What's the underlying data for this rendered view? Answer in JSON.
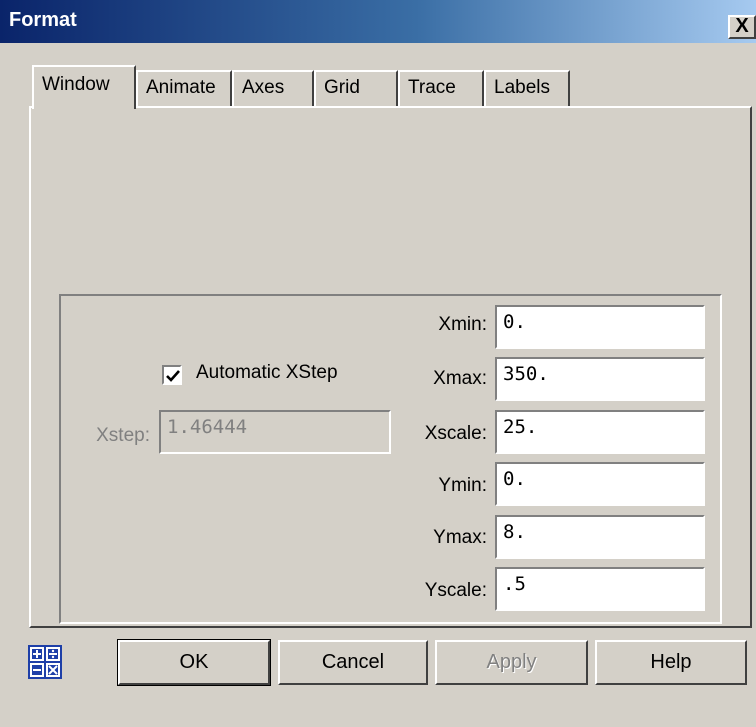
{
  "window": {
    "title": "Format",
    "close_glyph": "X"
  },
  "tabs": [
    {
      "label": "Window",
      "active": true
    },
    {
      "label": "Animate",
      "active": false
    },
    {
      "label": "Axes",
      "active": false
    },
    {
      "label": "Grid",
      "active": false
    },
    {
      "label": "Trace",
      "active": false
    },
    {
      "label": "Labels",
      "active": false
    }
  ],
  "window_settings": {
    "auto_xstep": {
      "label": "Automatic XStep",
      "checked": true
    },
    "xstep": {
      "label": "Xstep:",
      "value": "1.46444",
      "disabled": true
    },
    "xmin": {
      "label": "Xmin:",
      "value": "0."
    },
    "xmax": {
      "label": "Xmax:",
      "value": "350."
    },
    "xscale": {
      "label": "Xscale:",
      "value": "25."
    },
    "ymin": {
      "label": "Ymin:",
      "value": "0."
    },
    "ymax": {
      "label": "Ymax:",
      "value": "8."
    },
    "yscale": {
      "label": "Yscale:",
      "value": ".5"
    }
  },
  "buttons": {
    "ok": "OK",
    "cancel": "Cancel",
    "apply": "Apply",
    "help": "Help"
  },
  "icons": {
    "calculator": "calculator-icon",
    "check": "check-icon"
  }
}
